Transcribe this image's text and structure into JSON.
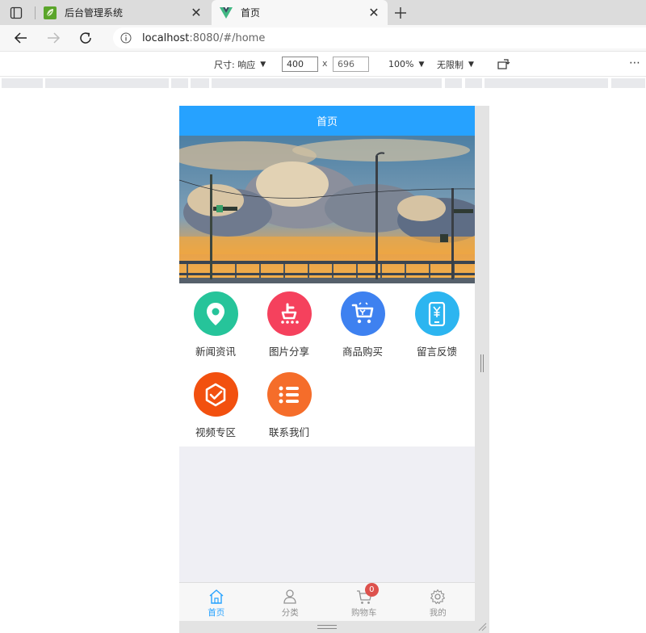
{
  "browser": {
    "tabs": [
      {
        "title": "后台管理系统",
        "favicon": "leaf-icon",
        "active": false
      },
      {
        "title": "首页",
        "favicon": "vue-icon",
        "active": true
      }
    ],
    "url_host": "localhost",
    "url_rest": ":8080/#/home"
  },
  "devtools": {
    "dimensions_label": "尺寸: 响应",
    "width": "400",
    "height": "696",
    "times": "x",
    "zoom": "100%",
    "throttle": "无限制",
    "more": "⋯"
  },
  "app": {
    "header_title": "首页",
    "grid": [
      {
        "label": "新闻资讯",
        "icon": "location-pin-icon",
        "color": "#26c49a"
      },
      {
        "label": "图片分享",
        "icon": "dianping-icon",
        "color": "#f5415d"
      },
      {
        "label": "商品购买",
        "icon": "shopping-cart-icon",
        "color": "#3e81f0"
      },
      {
        "label": "留言反馈",
        "icon": "mobile-yuan-icon",
        "color": "#2cb5f0"
      },
      {
        "label": "视频专区",
        "icon": "check-badge-icon",
        "color": "#f2500f"
      },
      {
        "label": "联系我们",
        "icon": "list-icon",
        "color": "#f56d2a"
      }
    ],
    "tabbar": [
      {
        "label": "首页",
        "icon": "home-icon",
        "active": true
      },
      {
        "label": "分类",
        "icon": "person-icon",
        "active": false
      },
      {
        "label": "购物车",
        "icon": "cart-icon",
        "active": false,
        "badge": "0"
      },
      {
        "label": "我的",
        "icon": "gear-icon",
        "active": false
      }
    ],
    "colors": {
      "header": "#26a2ff",
      "active": "#26a2ff",
      "inactive": "#929292",
      "badge": "#dd524d"
    }
  }
}
